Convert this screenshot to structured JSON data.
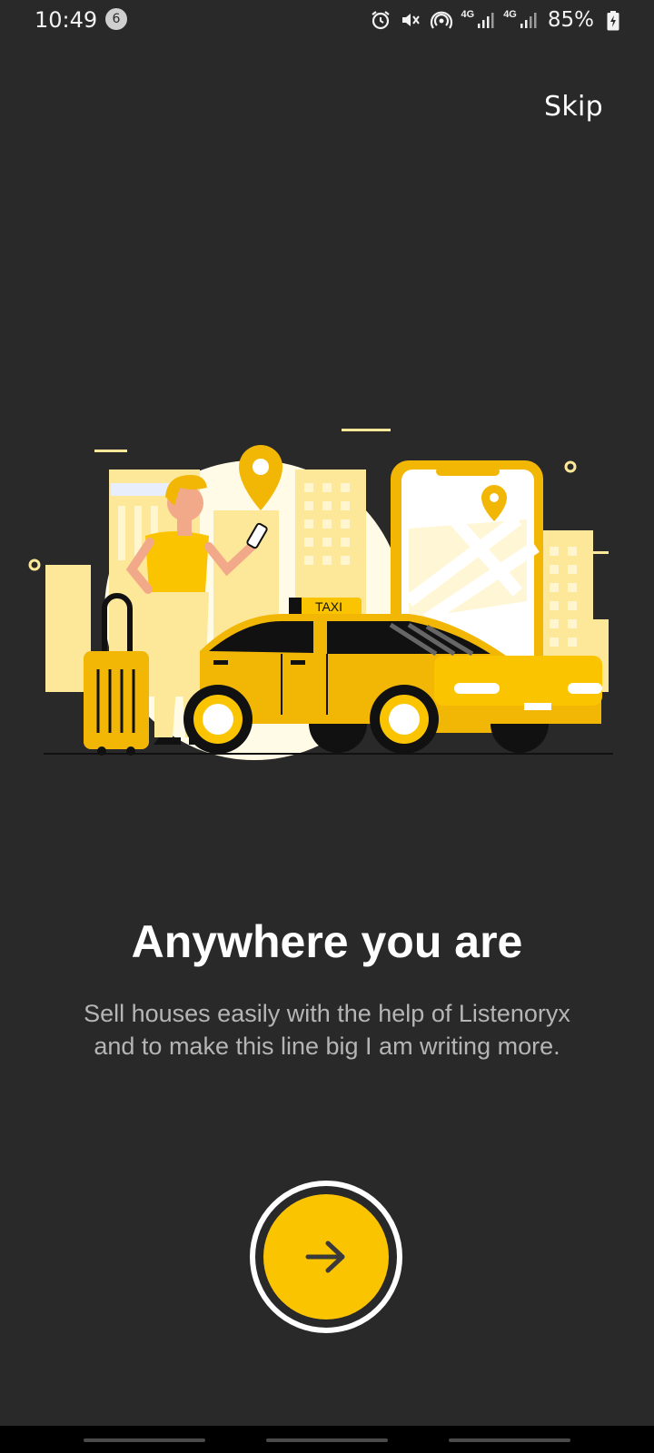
{
  "status_bar": {
    "time": "10:49",
    "notification_count": "6",
    "battery_percent": "85%",
    "network_label_1": "4G",
    "network_label_2": "4G"
  },
  "skip_label": "Skip",
  "illustration": {
    "taxi_sign": "TAXI"
  },
  "headline": "Anywhere you are",
  "subtitle": "Sell houses easily with the help of Listenoryx and to make this line big I am writing more.",
  "colors": {
    "background": "#292929",
    "accent": "#fbc400",
    "light_yellow": "#fde89a",
    "subtitle_text": "#b5b5b5"
  }
}
